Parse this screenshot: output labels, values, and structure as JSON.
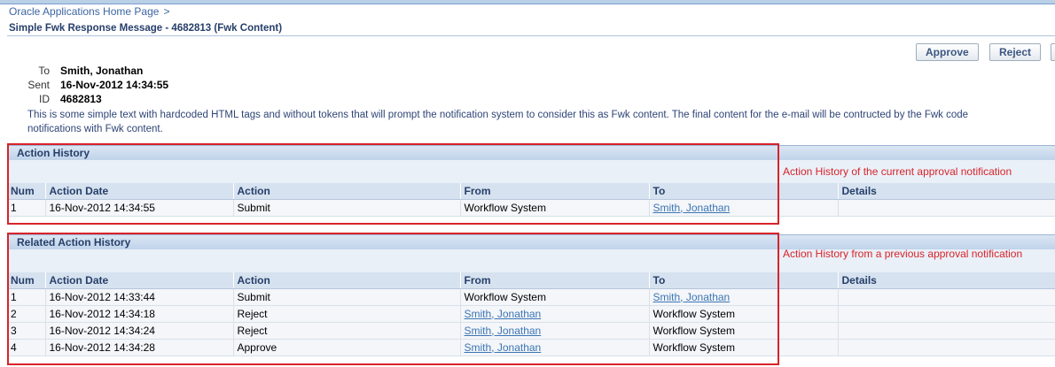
{
  "breadcrumb": {
    "home_label": "Oracle Applications Home Page",
    "separator": ">"
  },
  "page": {
    "title": "Simple Fwk Response Message - 4682813 (Fwk Content)"
  },
  "buttons": {
    "approve_label": "Approve",
    "reject_label": "Reject"
  },
  "notification": {
    "to_label": "To",
    "to_value": "Smith, Jonathan",
    "sent_label": "Sent",
    "sent_value": "16-Nov-2012 14:34:55",
    "id_label": "ID",
    "id_value": "4682813",
    "body": "This is some simple text with hardcoded HTML tags and without tokens that will prompt the notification system to consider this as Fwk content. The final content for the e-mail will be contructed by the Fwk code\nnotifications with Fwk content."
  },
  "action_history": {
    "title": "Action History",
    "columns": [
      "Num",
      "Action Date",
      "Action",
      "From",
      "To",
      "Details"
    ],
    "rows": [
      {
        "num": "1",
        "date": "16-Nov-2012 14:34:55",
        "action": "Submit",
        "from": "Workflow System",
        "from_link": false,
        "to": "Smith, Jonathan",
        "to_link": true,
        "details": ""
      }
    ],
    "annotation": "Action History of the current approval notification"
  },
  "related_action_history": {
    "title": "Related Action History",
    "columns": [
      "Num",
      "Action Date",
      "Action",
      "From",
      "To",
      "Details"
    ],
    "rows": [
      {
        "num": "1",
        "date": "16-Nov-2012 14:33:44",
        "action": "Submit",
        "from": "Workflow System",
        "from_link": false,
        "to": "Smith, Jonathan",
        "to_link": true,
        "details": ""
      },
      {
        "num": "2",
        "date": "16-Nov-2012 14:34:18",
        "action": "Reject",
        "from": "Smith, Jonathan",
        "from_link": true,
        "to": "Workflow System",
        "to_link": false,
        "details": ""
      },
      {
        "num": "3",
        "date": "16-Nov-2012 14:34:24",
        "action": "Reject",
        "from": "Smith, Jonathan",
        "from_link": true,
        "to": "Workflow System",
        "to_link": false,
        "details": ""
      },
      {
        "num": "4",
        "date": "16-Nov-2012 14:34:28",
        "action": "Approve",
        "from": "Smith, Jonathan",
        "from_link": true,
        "to": "Workflow System",
        "to_link": false,
        "details": ""
      }
    ],
    "annotation": "Action History from a previous approval notification"
  },
  "colors": {
    "annotation_red": "#d8232a",
    "link_blue": "#3c75b4",
    "header_blue": "#263f6a"
  }
}
